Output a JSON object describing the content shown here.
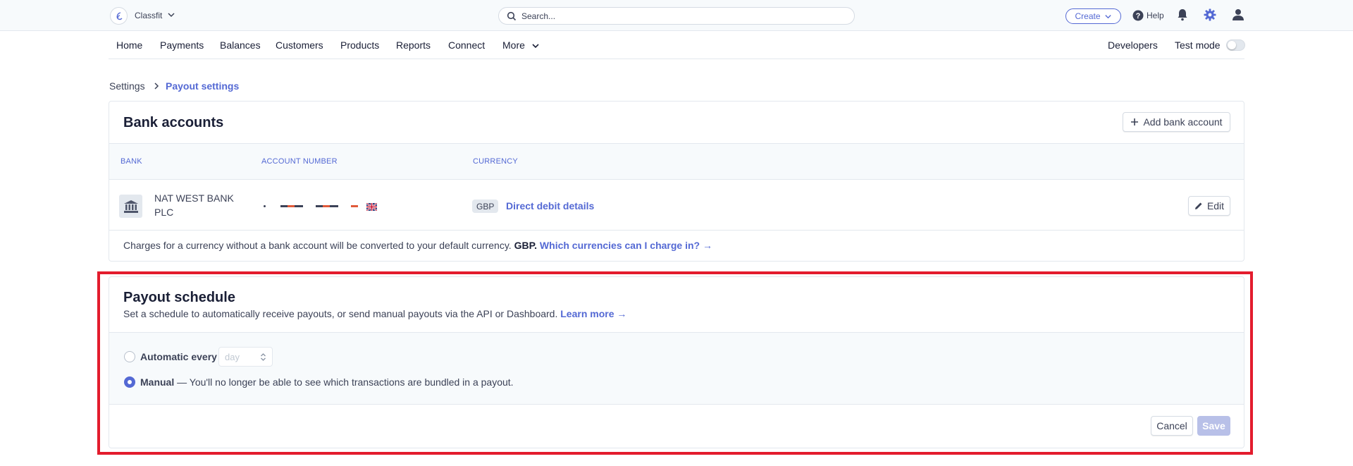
{
  "header": {
    "account_name": "Classfit",
    "search": {
      "placeholder": "Search..."
    },
    "create_label": "Create",
    "help_label": "Help",
    "colors": {
      "accent": "#5469d4",
      "highlight": "#e31c2d"
    }
  },
  "nav": {
    "items": [
      "Home",
      "Payments",
      "Balances",
      "Customers",
      "Products",
      "Reports",
      "Connect",
      "More"
    ],
    "developers_label": "Developers",
    "test_mode_label": "Test mode"
  },
  "breadcrumb": {
    "parent": "Settings",
    "current": "Payout settings"
  },
  "bank_accounts": {
    "title": "Bank accounts",
    "add_label": "Add bank account",
    "columns": [
      "BANK",
      "ACCOUNT NUMBER",
      "CURRENCY"
    ],
    "rows": [
      {
        "bank_line1": "NAT WEST BANK",
        "bank_line2": "PLC",
        "account_number": "• ▬▬ ▬▬ ▬",
        "currency": "GBP",
        "details_link": "Direct debit details",
        "edit_label": "Edit"
      }
    ],
    "footer": {
      "text": "Charges for a currency without a bank account will be converted to your default currency.",
      "default_currency": "GBP.",
      "link": "Which currencies can I charge in? →"
    }
  },
  "payout_schedule": {
    "title": "Payout schedule",
    "description": "Set a schedule to automatically receive payouts, or send manual payouts via the API or Dashboard.",
    "learn_more": "Learn more →",
    "options": {
      "automatic_label": "Automatic every",
      "automatic_selected": false,
      "interval_value": "day",
      "manual_label": "Manual",
      "manual_note": "— You'll no longer be able to see which transactions are bundled in a payout.",
      "manual_selected": true
    },
    "cancel_label": "Cancel",
    "save_label": "Save"
  }
}
